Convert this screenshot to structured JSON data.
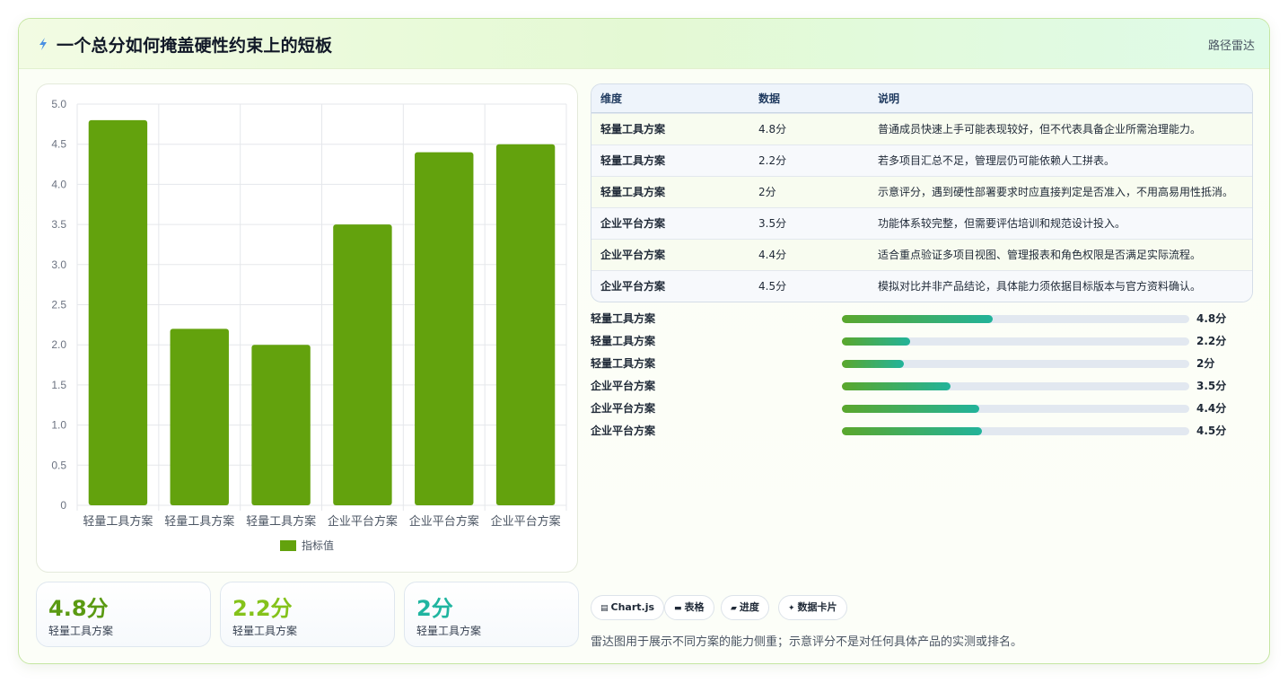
{
  "header": {
    "icon": "lightning-icon",
    "title": "一个总分如何掩盖硬性约束上的短板",
    "tag": "路径雷达"
  },
  "chart_data": {
    "type": "bar",
    "categories": [
      "轻量工具方案",
      "轻量工具方案",
      "轻量工具方案",
      "企业平台方案",
      "企业平台方案",
      "企业平台方案"
    ],
    "series": [
      {
        "name": "指标值",
        "values": [
          4.8,
          2.2,
          2.0,
          3.5,
          4.4,
          4.5
        ]
      }
    ],
    "ylim": [
      0,
      5.0
    ],
    "yticks": [
      "5.0",
      "4.5",
      "4.0",
      "3.5",
      "3.0",
      "2.5",
      "2.0",
      "1.5",
      "1.0",
      "0.5",
      "0"
    ],
    "grid": true,
    "legend_position": "bottom",
    "colors": {
      "bar": "#63a20d"
    }
  },
  "kpis": [
    {
      "value": "4.8分",
      "label": "轻量工具方案",
      "color": "#5a9a12"
    },
    {
      "value": "2.2分",
      "label": "轻量工具方案",
      "color": "#84c21a"
    },
    {
      "value": "2分",
      "label": "轻量工具方案",
      "color": "#1fb5a0"
    }
  ],
  "table": {
    "headers": [
      "维度",
      "数据",
      "说明"
    ],
    "rows": [
      [
        "轻量工具方案",
        "4.8分",
        "普通成员快速上手可能表现较好，但不代表具备企业所需治理能力。"
      ],
      [
        "轻量工具方案",
        "2.2分",
        "若多项目汇总不足，管理层仍可能依赖人工拼表。"
      ],
      [
        "轻量工具方案",
        "2分",
        "示意评分，遇到硬性部署要求时应直接判定是否准入，不用高易用性抵消。"
      ],
      [
        "企业平台方案",
        "3.5分",
        "功能体系较完整，但需要评估培训和规范设计投入。"
      ],
      [
        "企业平台方案",
        "4.4分",
        "适合重点验证多项目视图、管理报表和角色权限是否满足实际流程。"
      ],
      [
        "企业平台方案",
        "4.5分",
        "模拟对比并非产品结论，具体能力须依据目标版本与官方资料确认。"
      ]
    ]
  },
  "progress": [
    {
      "label": "轻量工具方案",
      "value": "4.8分",
      "fraction": 0.434
    },
    {
      "label": "轻量工具方案",
      "value": "2.2分",
      "fraction": 0.196
    },
    {
      "label": "轻量工具方案",
      "value": "2分",
      "fraction": 0.178
    },
    {
      "label": "企业平台方案",
      "value": "3.5分",
      "fraction": 0.313
    },
    {
      "label": "企业平台方案",
      "value": "4.4分",
      "fraction": 0.395
    },
    {
      "label": "企业平台方案",
      "value": "4.5分",
      "fraction": 0.403
    }
  ],
  "chips": [
    {
      "icon": "chart-icon",
      "glyph": "▤",
      "label": "Chart.js"
    },
    {
      "icon": "table-icon",
      "glyph": "▬",
      "label": "表格"
    },
    {
      "icon": "progress-icon",
      "glyph": "▰",
      "label": "进度"
    },
    {
      "icon": "sparkle-icon",
      "glyph": "✦",
      "label": "数据卡片"
    }
  ],
  "note": "雷达图用于展示不同方案的能力侧重；示意评分不是对任何具体产品的实测或排名。"
}
